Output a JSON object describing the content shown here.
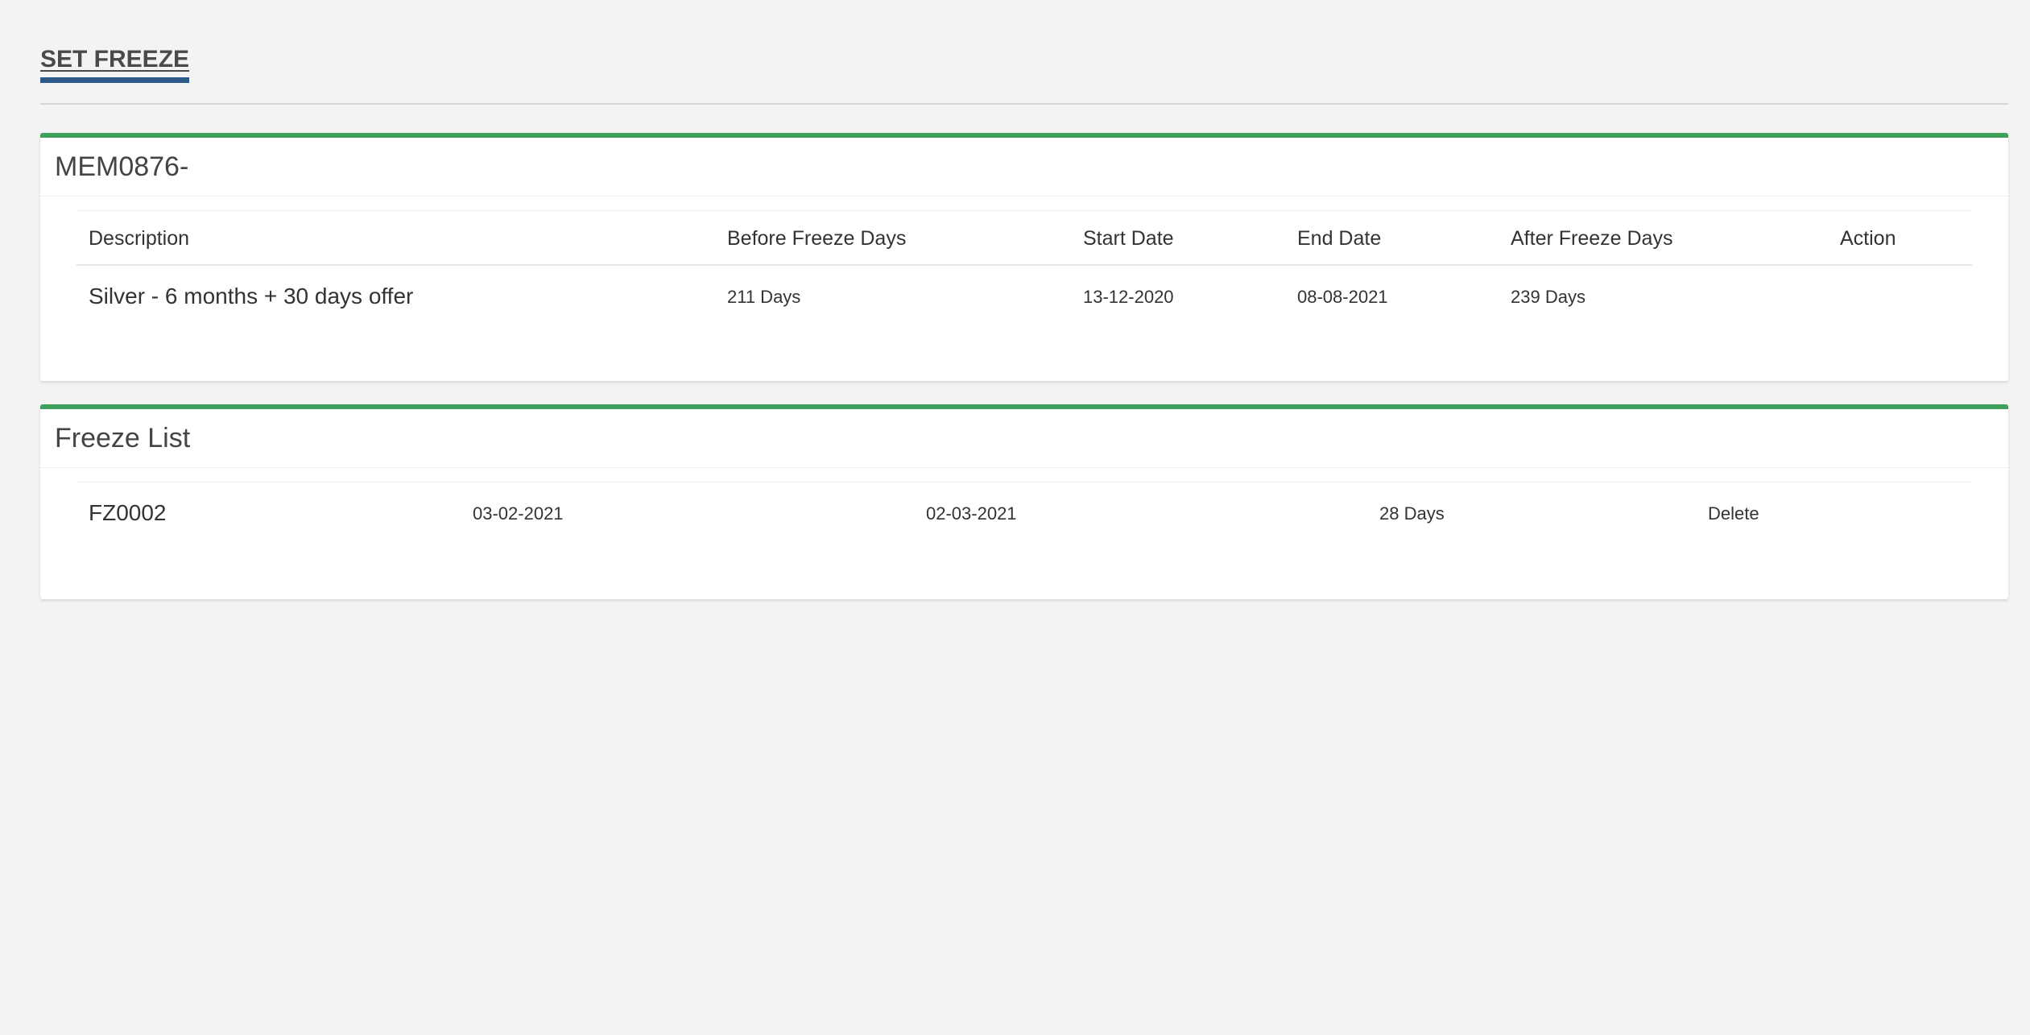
{
  "page": {
    "title": "SET FREEZE"
  },
  "member_box": {
    "title": "MEM0876-",
    "columns": {
      "description": "Description",
      "before_freeze_days": "Before Freeze Days",
      "start_date": "Start Date",
      "end_date": "End Date",
      "after_freeze_days": "After Freeze Days",
      "action": "Action"
    },
    "row": {
      "description": "Silver - 6 months + 30 days offer",
      "before_freeze_days": "211 Days",
      "start_date": "13-12-2020",
      "end_date": "08-08-2021",
      "after_freeze_days": "239 Days",
      "action": ""
    }
  },
  "freeze_box": {
    "title": "Freeze List",
    "rows": [
      {
        "id": "FZ0002",
        "start_date": "03-02-2021",
        "end_date": "02-03-2021",
        "days": "28 Days",
        "action": "Delete"
      }
    ]
  },
  "colors": {
    "page_bg": "#f3f3f3",
    "box_accent": "#3ea05a",
    "title_underline": "#2e5a8a",
    "link": "#3c8dbc"
  }
}
